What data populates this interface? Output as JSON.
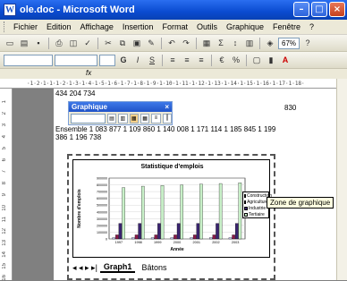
{
  "window": {
    "title": "ole.doc - Microsoft Word",
    "app_icon": "W"
  },
  "menu": [
    "Fichier",
    "Edition",
    "Affichage",
    "Insertion",
    "Format",
    "Outils",
    "Graphique",
    "Fenêtre",
    "?"
  ],
  "toolbar": {
    "zoom": "67%"
  },
  "ruler_text": "·1·2·1·1·1·2·1·3·1·4·1·5·1·6·1·7·1·8·1·9·1·10·1·11·1·12·1·13·1·14·1·15·1·16·1·17·1·18·",
  "doc": {
    "line1": "434  204 734",
    "line_right": "830",
    "line_ens": "Ensemble   1 083 877    1 109 860    1 140 008    1 171 114    1 185 845    1 199",
    "line_last": "386  1 196 738"
  },
  "graph_toolbar": {
    "title": "Graphique",
    "close": "×"
  },
  "tooltip": "Zone de graphique",
  "sheet_tabs": {
    "nav": "◂ ◂ ▸ ▸|",
    "active": "Graph1",
    "other": "Bâtons"
  },
  "chart_data": {
    "type": "bar",
    "title": "Statistique d'emplois",
    "xlabel": "Année",
    "ylabel": "Nombre d'emplois",
    "ylim": [
      0,
      900000
    ],
    "y_ticks": [
      "900000",
      "800000",
      "700000",
      "600000",
      "500000",
      "400000",
      "300000",
      "200000",
      "100000",
      "0"
    ],
    "categories": [
      "1997",
      "1998",
      "1999",
      "2000",
      "2001",
      "2002",
      "2003"
    ],
    "series": [
      {
        "name": "Construction",
        "values": [
          20000,
          20000,
          20000,
          20000,
          20000,
          20000,
          20000
        ]
      },
      {
        "name": "Agriculture",
        "values": [
          60000,
          60000,
          60000,
          60000,
          60000,
          60000,
          60000
        ]
      },
      {
        "name": "Industrie",
        "values": [
          230000,
          230000,
          230000,
          230000,
          230000,
          230000,
          230000
        ]
      },
      {
        "name": "Tertiaire",
        "values": [
          760000,
          780000,
          790000,
          800000,
          810000,
          820000,
          830000
        ]
      }
    ],
    "colors": [
      "#d0d0ff",
      "#8b1a4a",
      "#3a2470",
      "#c8f0c8"
    ]
  }
}
